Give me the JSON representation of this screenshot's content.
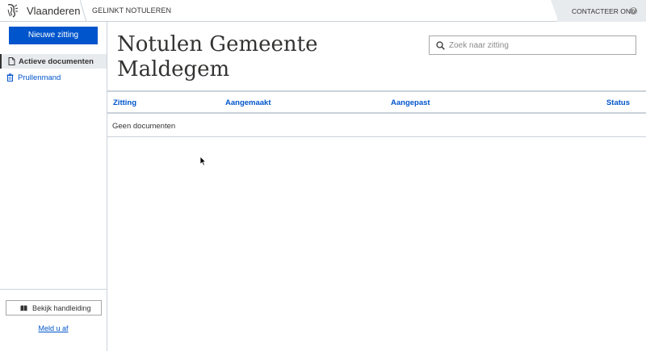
{
  "header": {
    "brand": "Vlaanderen",
    "app_name": "GELINKT NOTULEREN",
    "contact_label": "CONTACTEER ONS",
    "help_glyph": "?",
    "logo_icon": "flanders-lion-logo-icon"
  },
  "sidebar": {
    "new_button_label": "Nieuwe zitting",
    "items": [
      {
        "label": "Actieve documenten",
        "icon": "document-icon",
        "active": true
      },
      {
        "label": "Prullenmand",
        "icon": "trash-icon",
        "active": false
      }
    ],
    "manual_button_label": "Bekijk handleiding",
    "manual_icon": "book-icon",
    "logout_label": "Meld u af"
  },
  "main": {
    "title": "Notulen Gemeente Maldegem",
    "search": {
      "placeholder": "Zoek naar zitting",
      "value": ""
    },
    "table": {
      "columns": [
        "Zitting",
        "Aangemaakt",
        "Aangepast",
        "Status"
      ],
      "empty_message": "Geen documenten"
    }
  },
  "colors": {
    "accent": "#0055cc",
    "text": "#333332",
    "border": "#cbd2da",
    "muted_bg": "#e8ebee"
  }
}
